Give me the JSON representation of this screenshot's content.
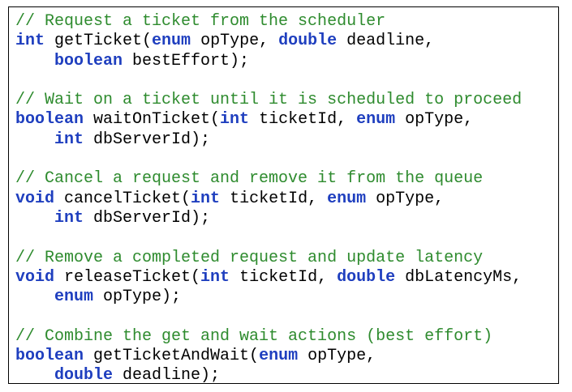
{
  "colors": {
    "comment": "#2e8b2e",
    "keyword": "#1f3fbf",
    "text": "#000000",
    "border": "#000000"
  },
  "blocks": [
    {
      "comment": "// Request a ticket from the scheduler",
      "lines": [
        [
          {
            "type": "kw",
            "text": "int"
          },
          {
            "type": "plain",
            "text": " getTicket("
          },
          {
            "type": "kw",
            "text": "enum"
          },
          {
            "type": "plain",
            "text": " opType, "
          },
          {
            "type": "kw",
            "text": "double"
          },
          {
            "type": "plain",
            "text": " deadline,"
          }
        ],
        [
          {
            "type": "plain",
            "text": "    "
          },
          {
            "type": "kw",
            "text": "boolean"
          },
          {
            "type": "plain",
            "text": " bestEffort);"
          }
        ]
      ]
    },
    {
      "comment": "// Wait on a ticket until it is scheduled to proceed",
      "lines": [
        [
          {
            "type": "kw",
            "text": "boolean"
          },
          {
            "type": "plain",
            "text": " waitOnTicket("
          },
          {
            "type": "kw",
            "text": "int"
          },
          {
            "type": "plain",
            "text": " ticketId, "
          },
          {
            "type": "kw",
            "text": "enum"
          },
          {
            "type": "plain",
            "text": " opType,"
          }
        ],
        [
          {
            "type": "plain",
            "text": "    "
          },
          {
            "type": "kw",
            "text": "int"
          },
          {
            "type": "plain",
            "text": " dbServerId);"
          }
        ]
      ]
    },
    {
      "comment": "// Cancel a request and remove it from the queue",
      "lines": [
        [
          {
            "type": "kw",
            "text": "void"
          },
          {
            "type": "plain",
            "text": " cancelTicket("
          },
          {
            "type": "kw",
            "text": "int"
          },
          {
            "type": "plain",
            "text": " ticketId, "
          },
          {
            "type": "kw",
            "text": "enum"
          },
          {
            "type": "plain",
            "text": " opType,"
          }
        ],
        [
          {
            "type": "plain",
            "text": "    "
          },
          {
            "type": "kw",
            "text": "int"
          },
          {
            "type": "plain",
            "text": " dbServerId);"
          }
        ]
      ]
    },
    {
      "comment": "// Remove a completed request and update latency",
      "lines": [
        [
          {
            "type": "kw",
            "text": "void"
          },
          {
            "type": "plain",
            "text": " releaseTicket("
          },
          {
            "type": "kw",
            "text": "int"
          },
          {
            "type": "plain",
            "text": " ticketId, "
          },
          {
            "type": "kw",
            "text": "double"
          },
          {
            "type": "plain",
            "text": " dbLatencyMs,"
          }
        ],
        [
          {
            "type": "plain",
            "text": "    "
          },
          {
            "type": "kw",
            "text": "enum"
          },
          {
            "type": "plain",
            "text": " opType);"
          }
        ]
      ]
    },
    {
      "comment": "// Combine the get and wait actions (best effort)",
      "lines": [
        [
          {
            "type": "kw",
            "text": "boolean"
          },
          {
            "type": "plain",
            "text": " getTicketAndWait("
          },
          {
            "type": "kw",
            "text": "enum"
          },
          {
            "type": "plain",
            "text": " opType,"
          }
        ],
        [
          {
            "type": "plain",
            "text": "    "
          },
          {
            "type": "kw",
            "text": "double"
          },
          {
            "type": "plain",
            "text": " deadline);"
          }
        ]
      ]
    }
  ]
}
